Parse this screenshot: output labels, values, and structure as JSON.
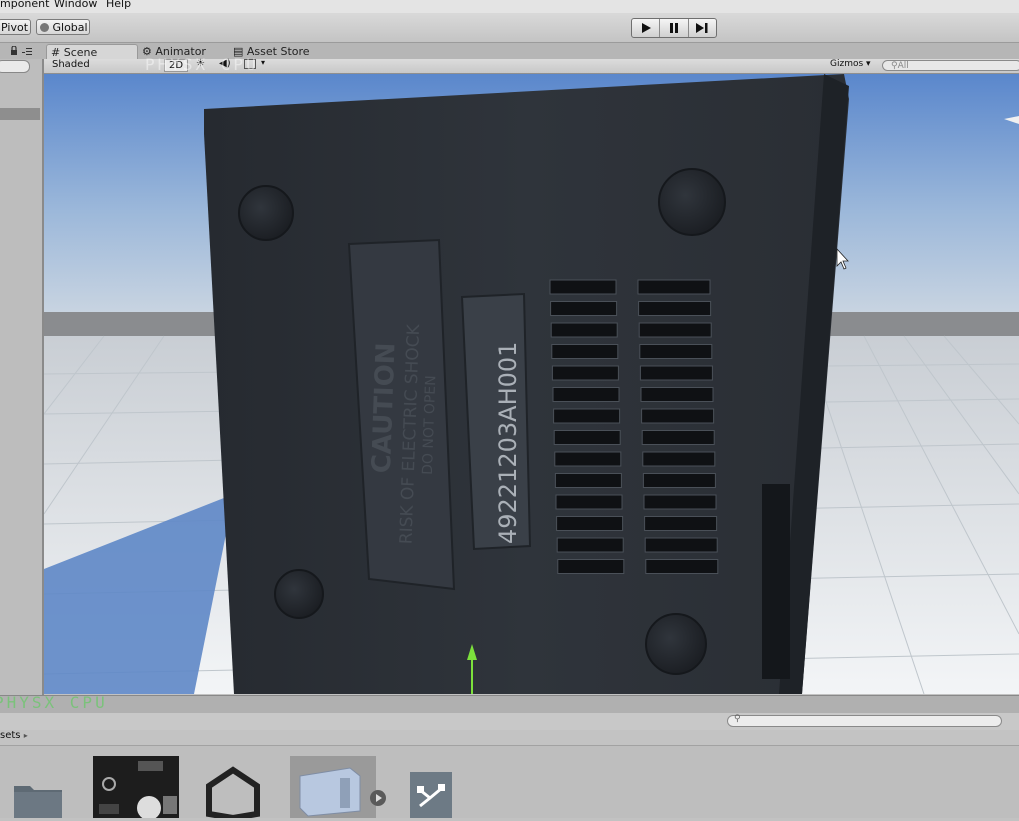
{
  "menu": {
    "component": "mponent",
    "window": "Window",
    "help": "Help"
  },
  "toolbar": {
    "pivot": "Pivot",
    "global": "Global"
  },
  "tabs": {
    "scene": "Scene",
    "animator": "Animator",
    "asset_store": "Asset Store"
  },
  "scene_toolbar": {
    "shading": "Shaded",
    "mode_2d": "2D",
    "gizmos": "Gizmos",
    "search_placeholder": "All"
  },
  "overlay": {
    "top_watermark": "PHYSX CPU",
    "bottom_watermark": "PHYSX CPU"
  },
  "model": {
    "label_caution_title": "CAUTION",
    "label_caution_line1": "RISK OF ELECTRIC SHOCK",
    "label_caution_line2": "DO NOT OPEN",
    "serial_number": "49221203AH001"
  },
  "project": {
    "breadcrumb": "sets"
  },
  "colors": {
    "sky_top": "#5f8ccf",
    "ground": "#e8ecef",
    "model": "#2c3138",
    "accent_green": "#7ce03c"
  }
}
